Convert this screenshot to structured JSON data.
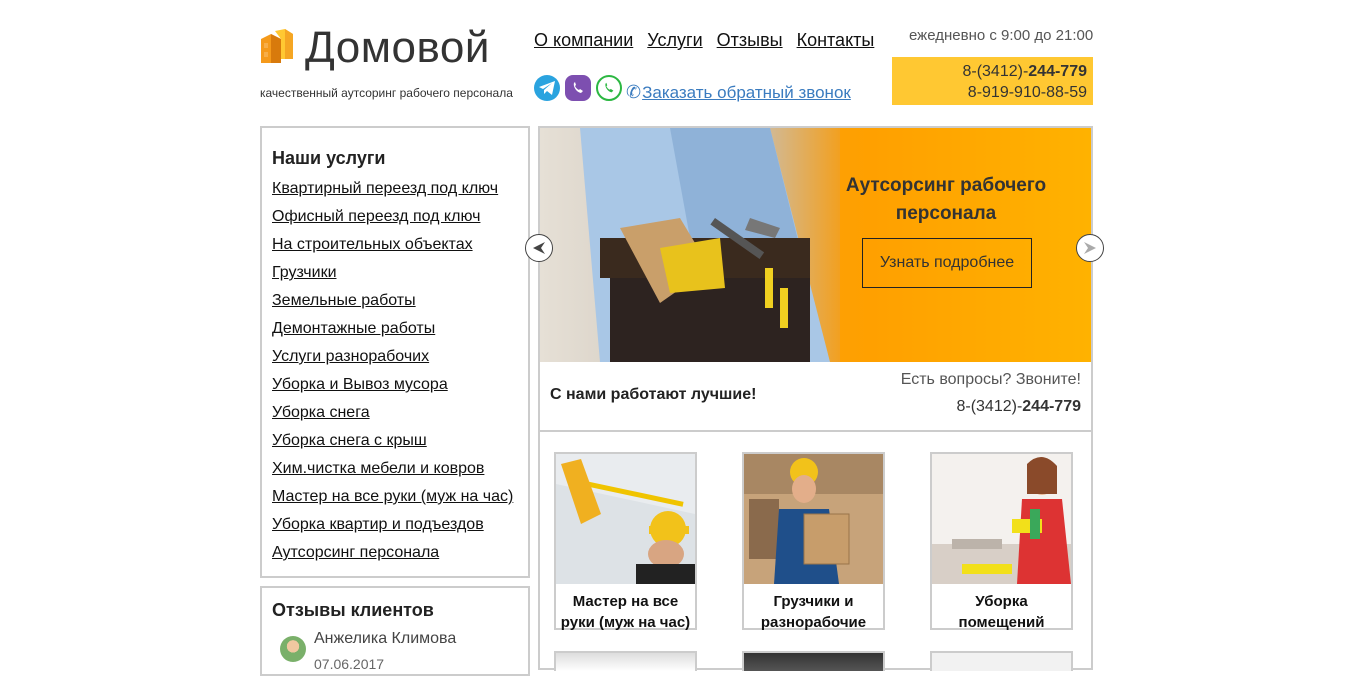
{
  "header": {
    "logo_text": "Домовой",
    "tagline": "качественный аутсоринг рабочего персонала",
    "nav": [
      "О компании",
      "Услуги",
      "Отзывы",
      "Контакты"
    ],
    "callback_link": "Заказать обратный звонок",
    "hours": "ежедневно с 9:00 до 21:00",
    "phone1_prefix": "8-(3412)-",
    "phone1_bold": "244-779",
    "phone2": "8-919-910-88-59",
    "messengers": [
      "telegram-icon",
      "viber-icon",
      "whatsapp-icon"
    ]
  },
  "sidebar": {
    "services_title": "Наши услуги",
    "services": [
      "Квартирный переезд под ключ",
      "Офисный переезд под ключ",
      "На строительных объектах",
      "Грузчики",
      "Земельные работы",
      "Демонтажные работы",
      "Услуги разнорабочих",
      "Уборка и Вывоз мусора",
      "Уборка снега",
      "Уборка снега с крыш",
      "Хим.чистка мебели и ковров",
      "Мастер на все руки (муж на час)",
      "Уборка квартир и подъездов",
      "Аутсорсинг персонала"
    ],
    "reviews_title": "Отзывы клиентов",
    "reviewer": "Анжелика Климова",
    "review_date": "07.06.2017"
  },
  "banner": {
    "title_line1": "Аутсорсинг рабочего",
    "title_line2": "персонала",
    "button": "Узнать подробнее"
  },
  "info": {
    "best": "С нами работают лучшие!",
    "question": "Есть вопросы? Звоните!",
    "phone_prefix": "8-(3412)-",
    "phone_bold": "244-779"
  },
  "cards": [
    {
      "line1": "Мастер на все",
      "line2": "руки (муж на час)"
    },
    {
      "line1": "Грузчики и",
      "line2": "разнорабочие"
    },
    {
      "line1": "Уборка",
      "line2": "помещений"
    }
  ],
  "colors": {
    "accent": "#ffc832",
    "banner": "#ffa000",
    "link": "#3a7bbf",
    "border": "#cccccc"
  }
}
